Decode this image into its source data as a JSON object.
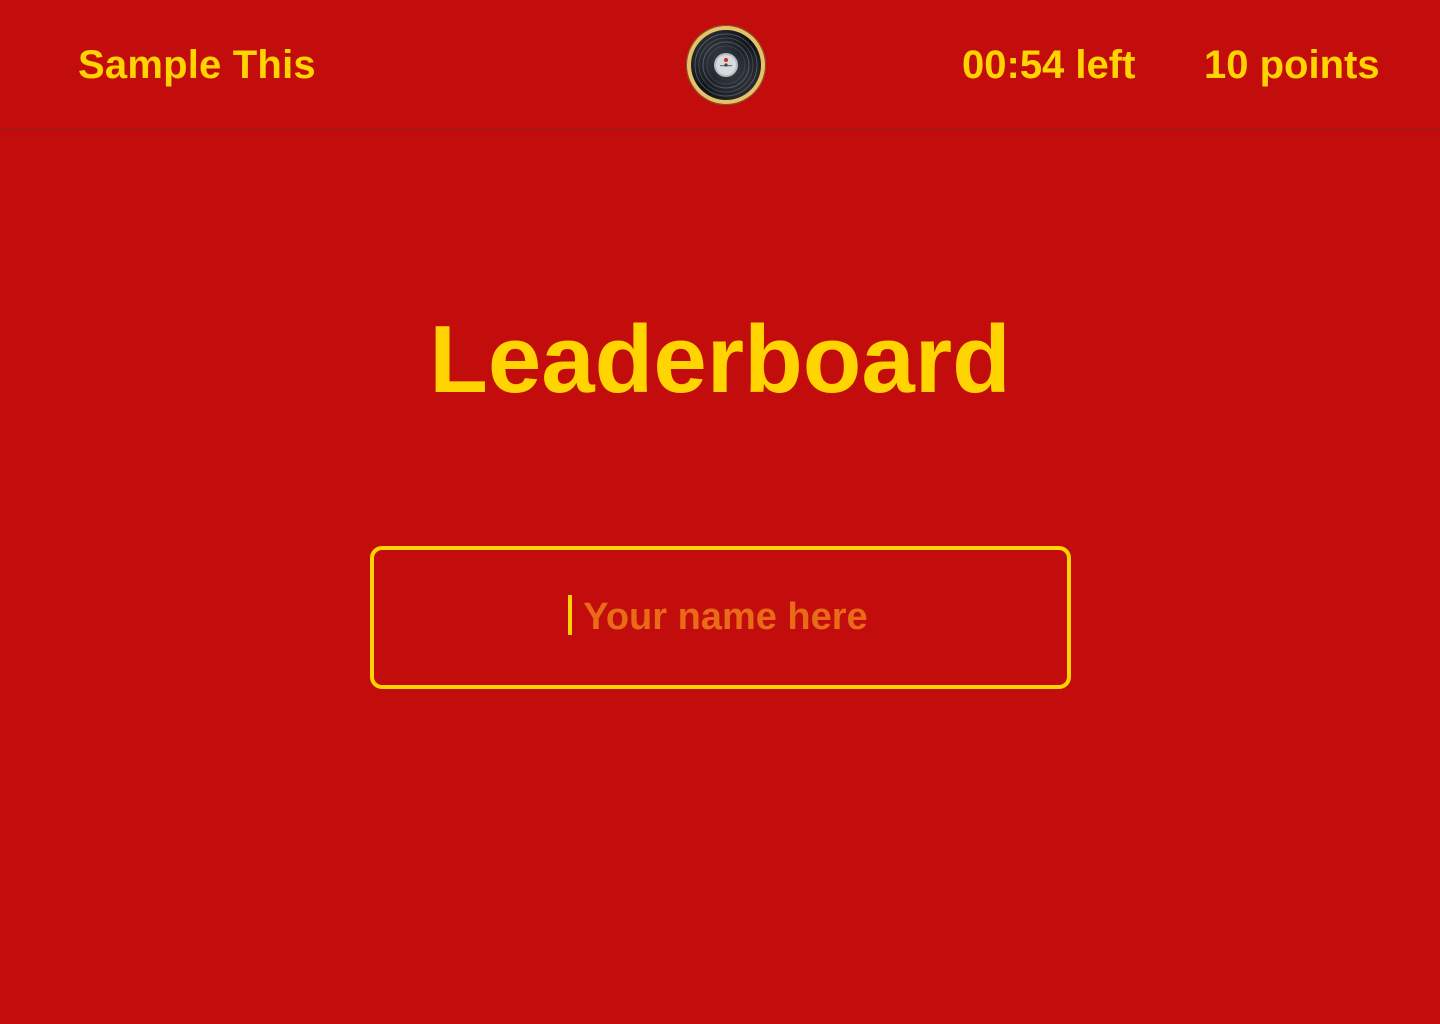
{
  "header": {
    "brand": "Sample This",
    "timer": "00:54 left",
    "score": "10 points",
    "record_icon": "vinyl-record-icon"
  },
  "main": {
    "title": "Leaderboard",
    "name_input": {
      "value": "",
      "placeholder": "Your name here"
    }
  },
  "colors": {
    "background": "#c30d0c",
    "accent": "#ffd400",
    "placeholder": "#e96b17"
  }
}
